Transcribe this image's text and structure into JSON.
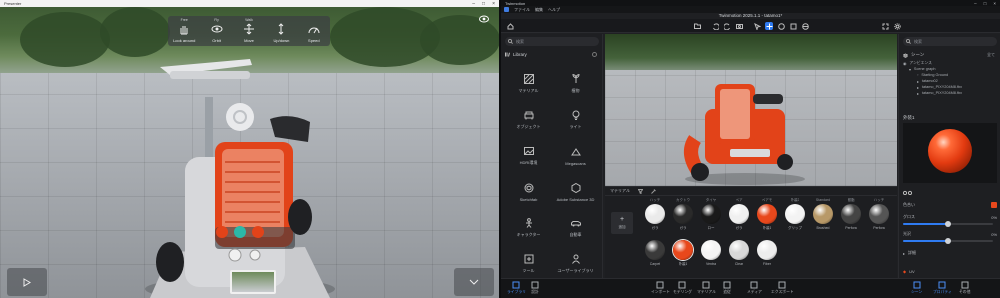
{
  "presenter": {
    "window_title": "Presenter",
    "nav_top_labels": [
      "Free",
      "Fly",
      "Walk"
    ],
    "nav_items": [
      {
        "label": "Look around",
        "icon": "hand-icon"
      },
      {
        "label": "Orbit",
        "icon": "orbit-icon"
      },
      {
        "label": "Move",
        "icon": "move-icon"
      },
      {
        "label": "Up/down",
        "icon": "up-down-icon"
      },
      {
        "label": "Speed",
        "icon": "speed-icon"
      }
    ]
  },
  "twinmotion": {
    "window_title": "Twinmotion",
    "app_title": "Twinmotion 2025.1.1 - tatamo1*",
    "menu": [
      "ファイル",
      "編集",
      "ヘルプ"
    ],
    "search_placeholder": "検索",
    "library": {
      "title": "Library",
      "items": [
        {
          "label": "マテリアル",
          "icon": "material-icon"
        },
        {
          "label": "植物",
          "icon": "plant-icon"
        },
        {
          "label": "オブジェクト",
          "icon": "object-icon"
        },
        {
          "label": "ライト",
          "icon": "light-icon"
        },
        {
          "label": "HDRI環境",
          "icon": "hdri-icon"
        },
        {
          "label": "Megascans",
          "icon": "megascans-icon"
        },
        {
          "label": "Sketchfab",
          "icon": "sketchfab-icon"
        },
        {
          "label": "Adobe Substance 3D",
          "icon": "substance-icon"
        },
        {
          "label": "キャラクター",
          "icon": "character-icon"
        },
        {
          "label": "自動車",
          "icon": "vehicle-icon"
        },
        {
          "label": "ツール",
          "icon": "tool-icon"
        },
        {
          "label": "ユーザーライブラリ",
          "icon": "user-library-icon"
        }
      ]
    },
    "material_panel": {
      "tab_label": "マテリアル",
      "add_label": "追加",
      "materials": [
        {
          "cap": "ハッチ",
          "name": "ガラ",
          "color": "#eaeaea"
        },
        {
          "cap": "カクトウ",
          "name": "ガラ",
          "color": "#2a2a2a"
        },
        {
          "cap": "タイヤ",
          "name": "ロー",
          "color": "#1a1a1a"
        },
        {
          "cap": "ペア",
          "name": "ガラ",
          "color": "#f0f0f0"
        },
        {
          "cap": "ペアモ",
          "name": "外装1",
          "color": "#e8481c"
        },
        {
          "cap": "外装2",
          "name": "グリップ",
          "color": "#f3f3f3"
        },
        {
          "cap": "Standard",
          "name": "Brushed",
          "color": "#b89968"
        },
        {
          "cap": "樹脂",
          "name": "Perfora",
          "color": "#444444"
        },
        {
          "cap": "ハッチ",
          "name": "Perfora",
          "color": "#555555"
        },
        {
          "cap": "",
          "name": "Carpet",
          "color": "#3a3a3a"
        },
        {
          "cap": "",
          "name": "外装1",
          "color": "#e8481c"
        },
        {
          "cap": "",
          "name": "Ventra",
          "color": "#f4f4f4"
        },
        {
          "cap": "",
          "name": "Clear",
          "color": "#d8d8d8"
        },
        {
          "cap": "",
          "name": "Fiber",
          "color": "#ededed"
        }
      ]
    },
    "scene": {
      "title": "シーン",
      "filter": "全て",
      "tree": [
        "アンビエンス",
        "Scene graph",
        "Starting Ground",
        "tatamo02",
        "tatamo_PIXY204M8.fbx",
        "tatamo_PIXY204M8.fbx"
      ]
    },
    "properties": {
      "material_title": "外装1",
      "color_label": "色合い",
      "gloss_label": "グロス",
      "gloss_value": 0.5,
      "gloss_pct": "0%",
      "rough_label": "光沢",
      "rough_value": 0.5,
      "rough_pct": "0%",
      "detail_label": "詳細",
      "uv_label": "UV",
      "accent_color": "#e8481c"
    },
    "bottom_bar": [
      {
        "label": "ライブラリ",
        "icon": "library-icon",
        "active": true
      },
      {
        "label": "設計",
        "icon": "design-icon",
        "active": false
      },
      {
        "label": "インポート",
        "icon": "import-icon",
        "active": false
      },
      {
        "label": "モデリング",
        "icon": "modeling-icon",
        "active": false
      },
      {
        "label": "マテリアル",
        "icon": "material-icon",
        "active": false
      },
      {
        "label": "追従",
        "icon": "follow-icon",
        "active": false
      },
      {
        "label": "メディア",
        "icon": "media-icon",
        "active": false
      },
      {
        "label": "エクスポート",
        "icon": "export-icon",
        "active": false
      },
      {
        "label": "シーン",
        "icon": "scene-icon",
        "active": true
      },
      {
        "label": "プロパティ",
        "icon": "properties-icon",
        "active": true
      },
      {
        "label": "その他",
        "icon": "more-icon",
        "active": false
      }
    ]
  }
}
